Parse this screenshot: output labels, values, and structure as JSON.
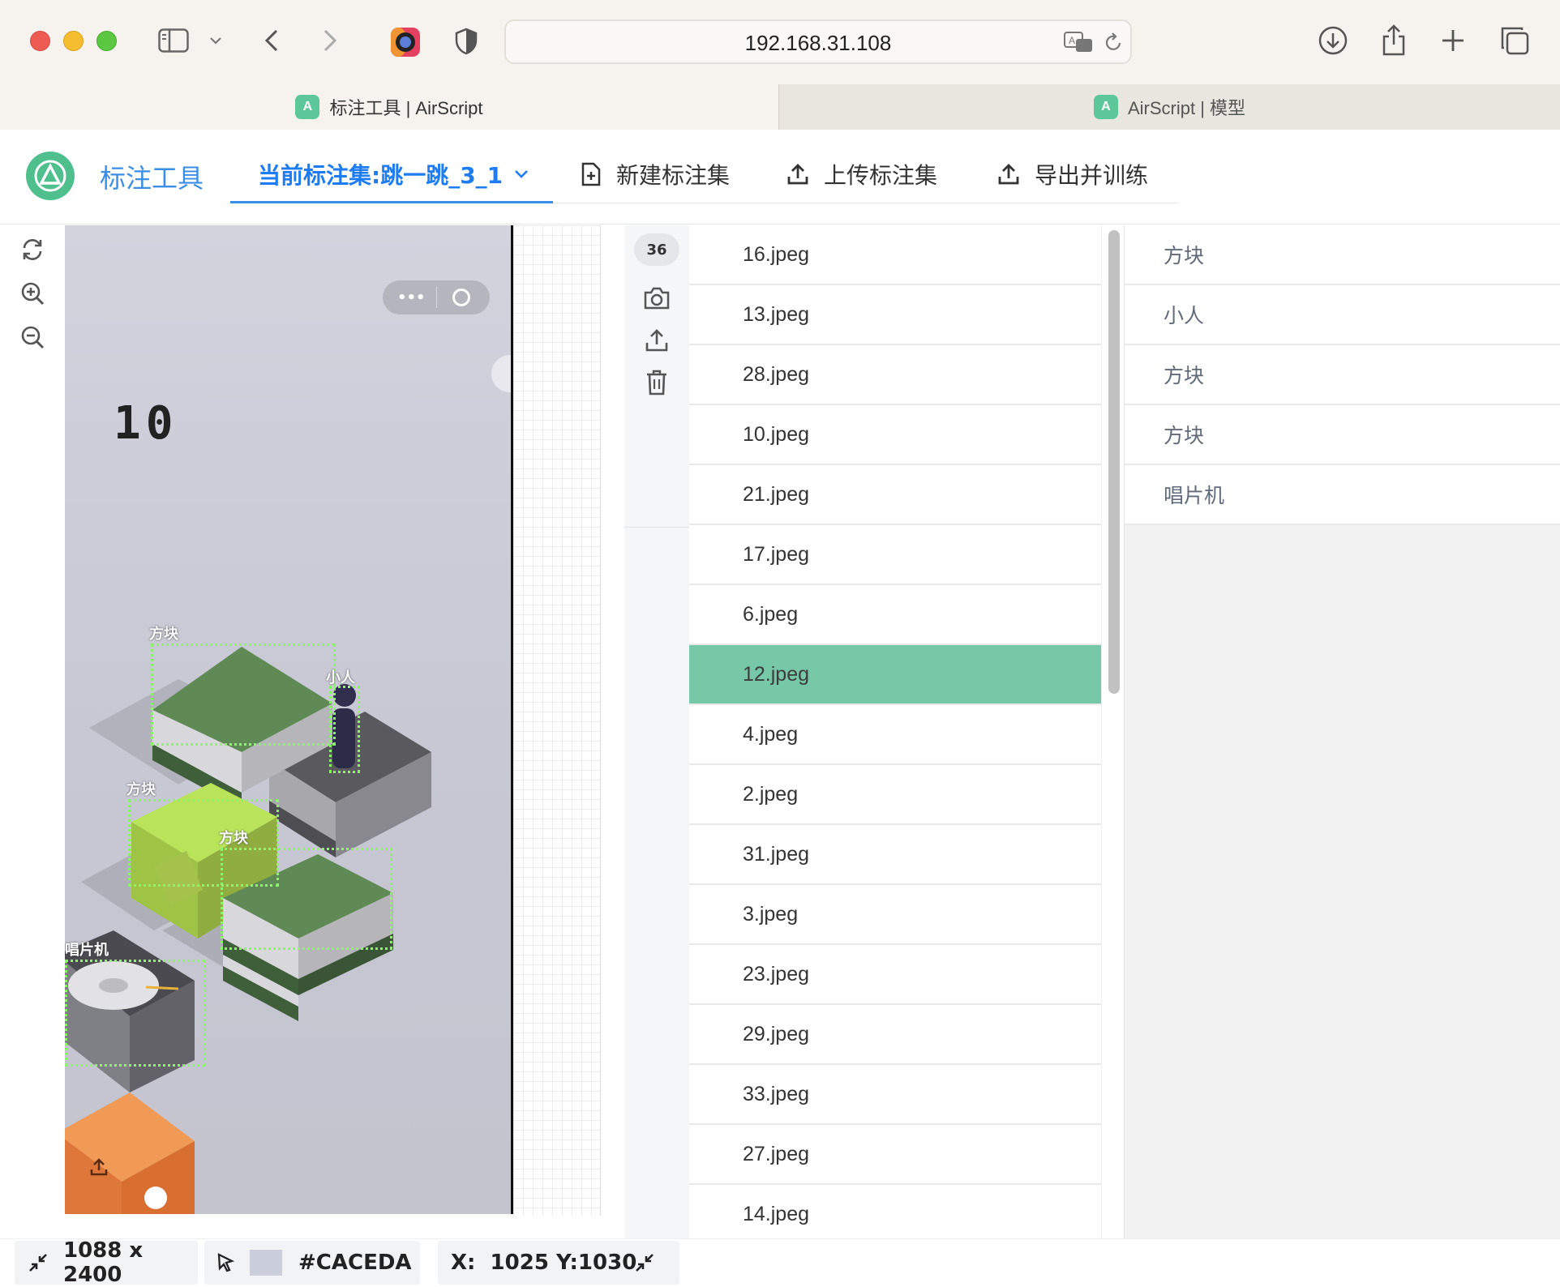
{
  "browser": {
    "url": "192.168.31.108",
    "tabs": [
      {
        "label": "标注工具 | AirScript",
        "active": true
      },
      {
        "label": "AirScript | 模型",
        "active": false
      }
    ]
  },
  "header": {
    "app_name": "标注工具",
    "nav": {
      "current_set": "当前标注集:跳一跳_3_1",
      "new_set": "新建标注集",
      "upload_set": "上传标注集",
      "export_train": "导出并训练"
    }
  },
  "canvas": {
    "score": "10",
    "annotations": [
      {
        "label": "方块"
      },
      {
        "label": "小人"
      },
      {
        "label": "方块"
      },
      {
        "label": "方块"
      },
      {
        "label": "唱片机"
      }
    ]
  },
  "sidebar": {
    "image_count": "36"
  },
  "files": [
    "16.jpeg",
    "13.jpeg",
    "28.jpeg",
    "10.jpeg",
    "21.jpeg",
    "17.jpeg",
    "6.jpeg",
    "12.jpeg",
    "4.jpeg",
    "2.jpeg",
    "31.jpeg",
    "3.jpeg",
    "23.jpeg",
    "29.jpeg",
    "33.jpeg",
    "27.jpeg",
    "14.jpeg"
  ],
  "selected_file": "12.jpeg",
  "labels": [
    "方块",
    "小人",
    "方块",
    "方块",
    "唱片机"
  ],
  "status": {
    "size": "1088 x 2400",
    "color_hex": "#CACEDA",
    "coords": "X:  1025 Y:1030"
  },
  "colors": {
    "accent": "#3a8ee6",
    "selected_row": "#76c8a6",
    "bbox": "#8df36b",
    "logo": "#4fc08d"
  }
}
